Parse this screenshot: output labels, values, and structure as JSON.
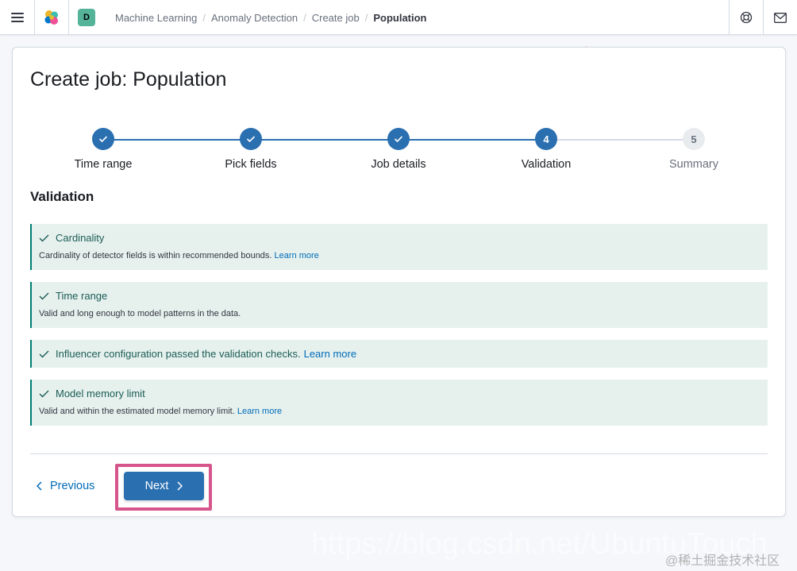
{
  "header": {
    "space_initial": "D",
    "breadcrumbs": [
      "Machine Learning",
      "Anomaly Detection",
      "Create job",
      "Population"
    ],
    "breadcrumb_separator": "/"
  },
  "page": {
    "title": "Create job: Population",
    "section_title": "Validation"
  },
  "steps": [
    {
      "label": "Time range",
      "state": "complete",
      "number": ""
    },
    {
      "label": "Pick fields",
      "state": "complete",
      "number": ""
    },
    {
      "label": "Job details",
      "state": "complete",
      "number": ""
    },
    {
      "label": "Validation",
      "state": "current",
      "number": "4"
    },
    {
      "label": "Summary",
      "state": "incomplete",
      "number": "5"
    }
  ],
  "validation": [
    {
      "title": "Cardinality",
      "body": "Cardinality of detector fields is within recommended bounds.",
      "link": "Learn more"
    },
    {
      "title": "Time range",
      "body": "Valid and long enough to model patterns in the data.",
      "link": ""
    },
    {
      "title": "Influencer configuration passed the validation checks.",
      "body": "",
      "link": "Learn more"
    },
    {
      "title": "Model memory limit",
      "body": "Valid and within the estimated model memory limit.",
      "link": "Learn more"
    }
  ],
  "footer": {
    "previous_label": "Previous",
    "next_label": "Next"
  },
  "watermark": {
    "url": "https://blog.csdn.net/UbuntuTouch",
    "sub": "@稀土掘金技术社区"
  },
  "colors": {
    "primary": "#2a6fb0",
    "success_bg": "#e6f1ee",
    "success_text": "#1c5c55",
    "highlight": "#d6558b"
  },
  "icons": [
    "menu-icon",
    "elastic-logo-icon",
    "help-icon",
    "mail-icon",
    "check-icon",
    "chevron-left-icon",
    "chevron-right-icon"
  ]
}
